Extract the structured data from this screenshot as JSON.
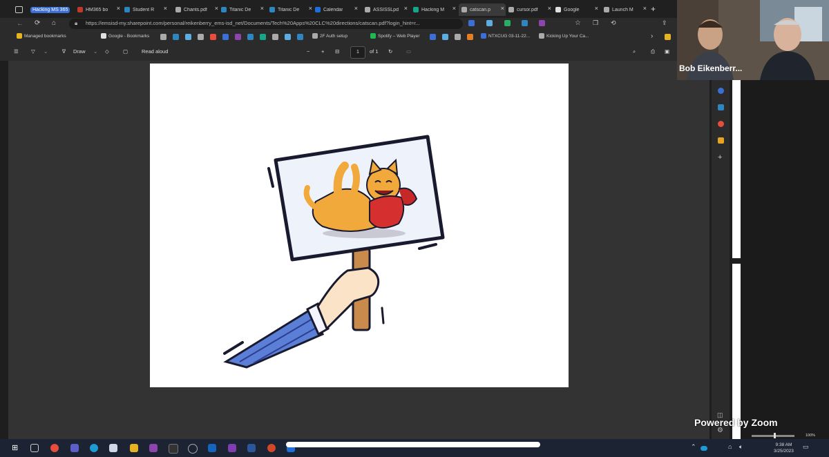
{
  "tabs": {
    "group_label": "Hacking MS 365",
    "items": [
      {
        "label": "HM365 bo",
        "color": "#c0392b"
      },
      {
        "label": "Student R",
        "color": "#2e86c1"
      },
      {
        "label": "Chants.pdf",
        "color": "#aaaaaa"
      },
      {
        "label": "Titanic De",
        "color": "#2e86c1"
      },
      {
        "label": "Titanic De",
        "color": "#2e86c1"
      },
      {
        "label": "Calendar",
        "color": "#1e6fd9"
      },
      {
        "label": "ASSISSLpd",
        "color": "#aaaaaa"
      },
      {
        "label": "Hacking M",
        "color": "#17a589"
      },
      {
        "label": "catscan.p",
        "color": "#aaaaaa"
      },
      {
        "label": "cursor.pdf",
        "color": "#aaaaaa"
      },
      {
        "label": "Google",
        "color": "#e0e0e0"
      },
      {
        "label": "Launch M",
        "color": "#aaaaaa"
      }
    ],
    "close_glyph": "×",
    "new_tab_glyph": "+"
  },
  "address": {
    "url": "https://emsisd-my.sharepoint.com/personal/reikenberry_ems-isd_net/Documents/Tech%20Apps%20CLC%20directions/catscan.pdf?login_hint=r..."
  },
  "bookmarks": [
    {
      "label": "Managed bookmarks",
      "color": "#e6b422"
    },
    {
      "label": "Google - Bookmarks",
      "color": "#e0e0e0"
    },
    {
      "label": "2F Auth setup",
      "color": "#aaaaaa"
    },
    {
      "label": "Spotify – Web Player",
      "color": "#1db954"
    },
    {
      "label": "NTXCUG 03-11-22...",
      "color": "#3b6fd6"
    },
    {
      "label": "Kicking Up Your Ca...",
      "color": "#aaaaaa"
    }
  ],
  "pdf_toolbar": {
    "draw_label": "Draw",
    "read_aloud_label": "Read aloud",
    "page_number": "1",
    "page_total": "of 1"
  },
  "zoom": {
    "participant_name": "Bob Eikenberr...",
    "powered_by": "Powered by Zoom",
    "zoom_level": "100%"
  },
  "taskbar": {
    "time": "9:38 AM",
    "date": "3/25/2023"
  }
}
